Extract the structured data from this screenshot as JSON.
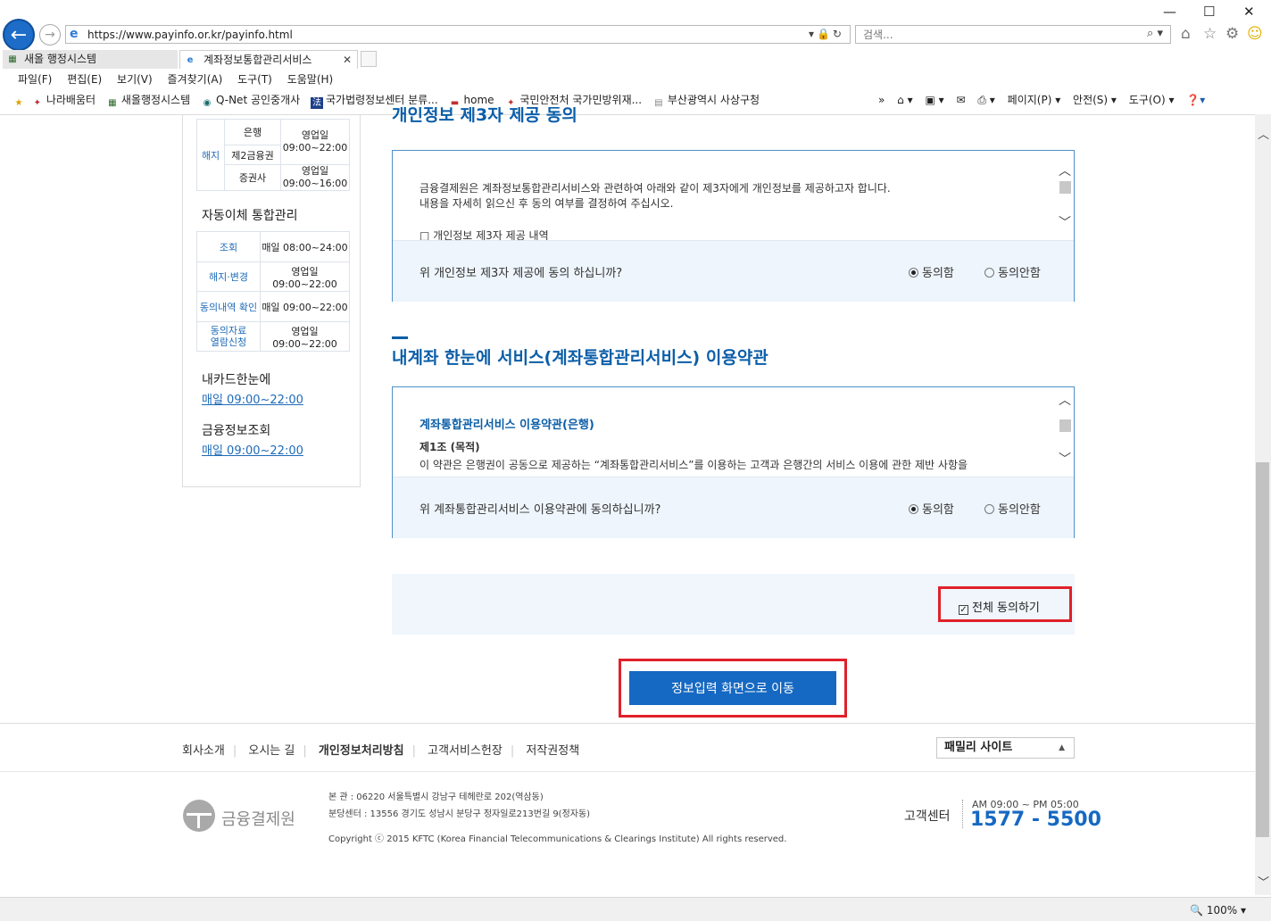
{
  "browser": {
    "url": "https://www.payinfo.or.kr/payinfo.html",
    "search_placeholder": "검색...",
    "tabs": [
      {
        "label": "새올 행정시스템"
      },
      {
        "label": "계좌정보통합관리서비스"
      }
    ],
    "menu": [
      "파일(F)",
      "편집(E)",
      "보기(V)",
      "즐겨찾기(A)",
      "도구(T)",
      "도움말(H)"
    ],
    "favorites": [
      "나라배움터",
      "새올행정시스템",
      "Q-Net 공인중개사",
      "국가법령정보센터 분류...",
      "home",
      "국민안전처 국가민방위재...",
      "부산광역시 사상구청"
    ],
    "commands": [
      "페이지(P) ▾",
      "안전(S) ▾",
      "도구(O) ▾"
    ],
    "zoom": "100%"
  },
  "sidebar": {
    "table1": {
      "row_label": "해지",
      "rows": [
        {
          "org": "은행",
          "time": "영업일\n09:00~22:00"
        },
        {
          "org": "제2금융권",
          "time": ""
        },
        {
          "org": "증권사",
          "time": "영업일\n09:00~16:00"
        }
      ]
    },
    "autopay_title": "자동이체 통합관리",
    "table2": [
      {
        "label": "조회",
        "time": "매일 08:00~24:00"
      },
      {
        "label": "해지·변경",
        "time": "영업일 09:00~22:00"
      },
      {
        "label": "동의내역 확인",
        "time": "매일 09:00~22:00"
      },
      {
        "label": "동의자료\n열람신청",
        "time": "영업일 09:00~22:00"
      }
    ],
    "card_title": "내카드한눈에",
    "card_time": "매일 09:00~22:00",
    "fin_title": "금융정보조회",
    "fin_time": "매일 09:00~22:00"
  },
  "section1": {
    "title": "개인정보 제3자 제공 동의",
    "lines": [
      "금융결제원은 계좌정보통합관리서비스와 관련하여 아래와 같이 제3자에게 개인정보를 제공하고자 합니다.",
      "내용을 자세히 읽으신 후 동의 여부를 결정하여 주십시오.",
      "□ 개인정보 제3자 제공 내역"
    ],
    "question": "위 개인정보 제3자 제공에 동의 하십니까?",
    "agree": "동의함",
    "disagree": "동의안함"
  },
  "section2": {
    "title": "내계좌 한눈에 서비스(계좌통합관리서비스) 이용약관",
    "subtitle": "계좌통합관리서비스 이용약관(은행)",
    "article": "제1조 (목적)",
    "body": "이 약관은 은행권이 공동으로 제공하는 “계좌통합관리서비스”를 이용하는 고객과 은행간의 서비스 이용에 관한 제반 사항을",
    "question": "위 계좌통합관리서비스 이용약관에 동의하십니까?",
    "agree": "동의함",
    "disagree": "동의안함"
  },
  "agree_all": "전체 동의하기",
  "go_button": "정보입력 화면으로 이동",
  "footer": {
    "links": [
      "회사소개",
      "오시는 길",
      "개인정보처리방침",
      "고객서비스헌장",
      "저작권정책"
    ],
    "family": "패밀리 사이트",
    "org_name": "금융결제원",
    "address1": "본      관 : 06220 서울특별시 강남구 테헤란로 202(역삼동)",
    "address2": "분당센터 : 13556 경기도 성남시 분당구 정자일로213번길 9(정자동)",
    "copyright": "Copyright ⓒ 2015 KFTC (Korea Financial Telecommunications & Clearings Institute) All rights reserved.",
    "center_label": "고객센터",
    "hours": "AM 09:00 ~ PM 05:00",
    "phone": "1577 - 5500"
  }
}
